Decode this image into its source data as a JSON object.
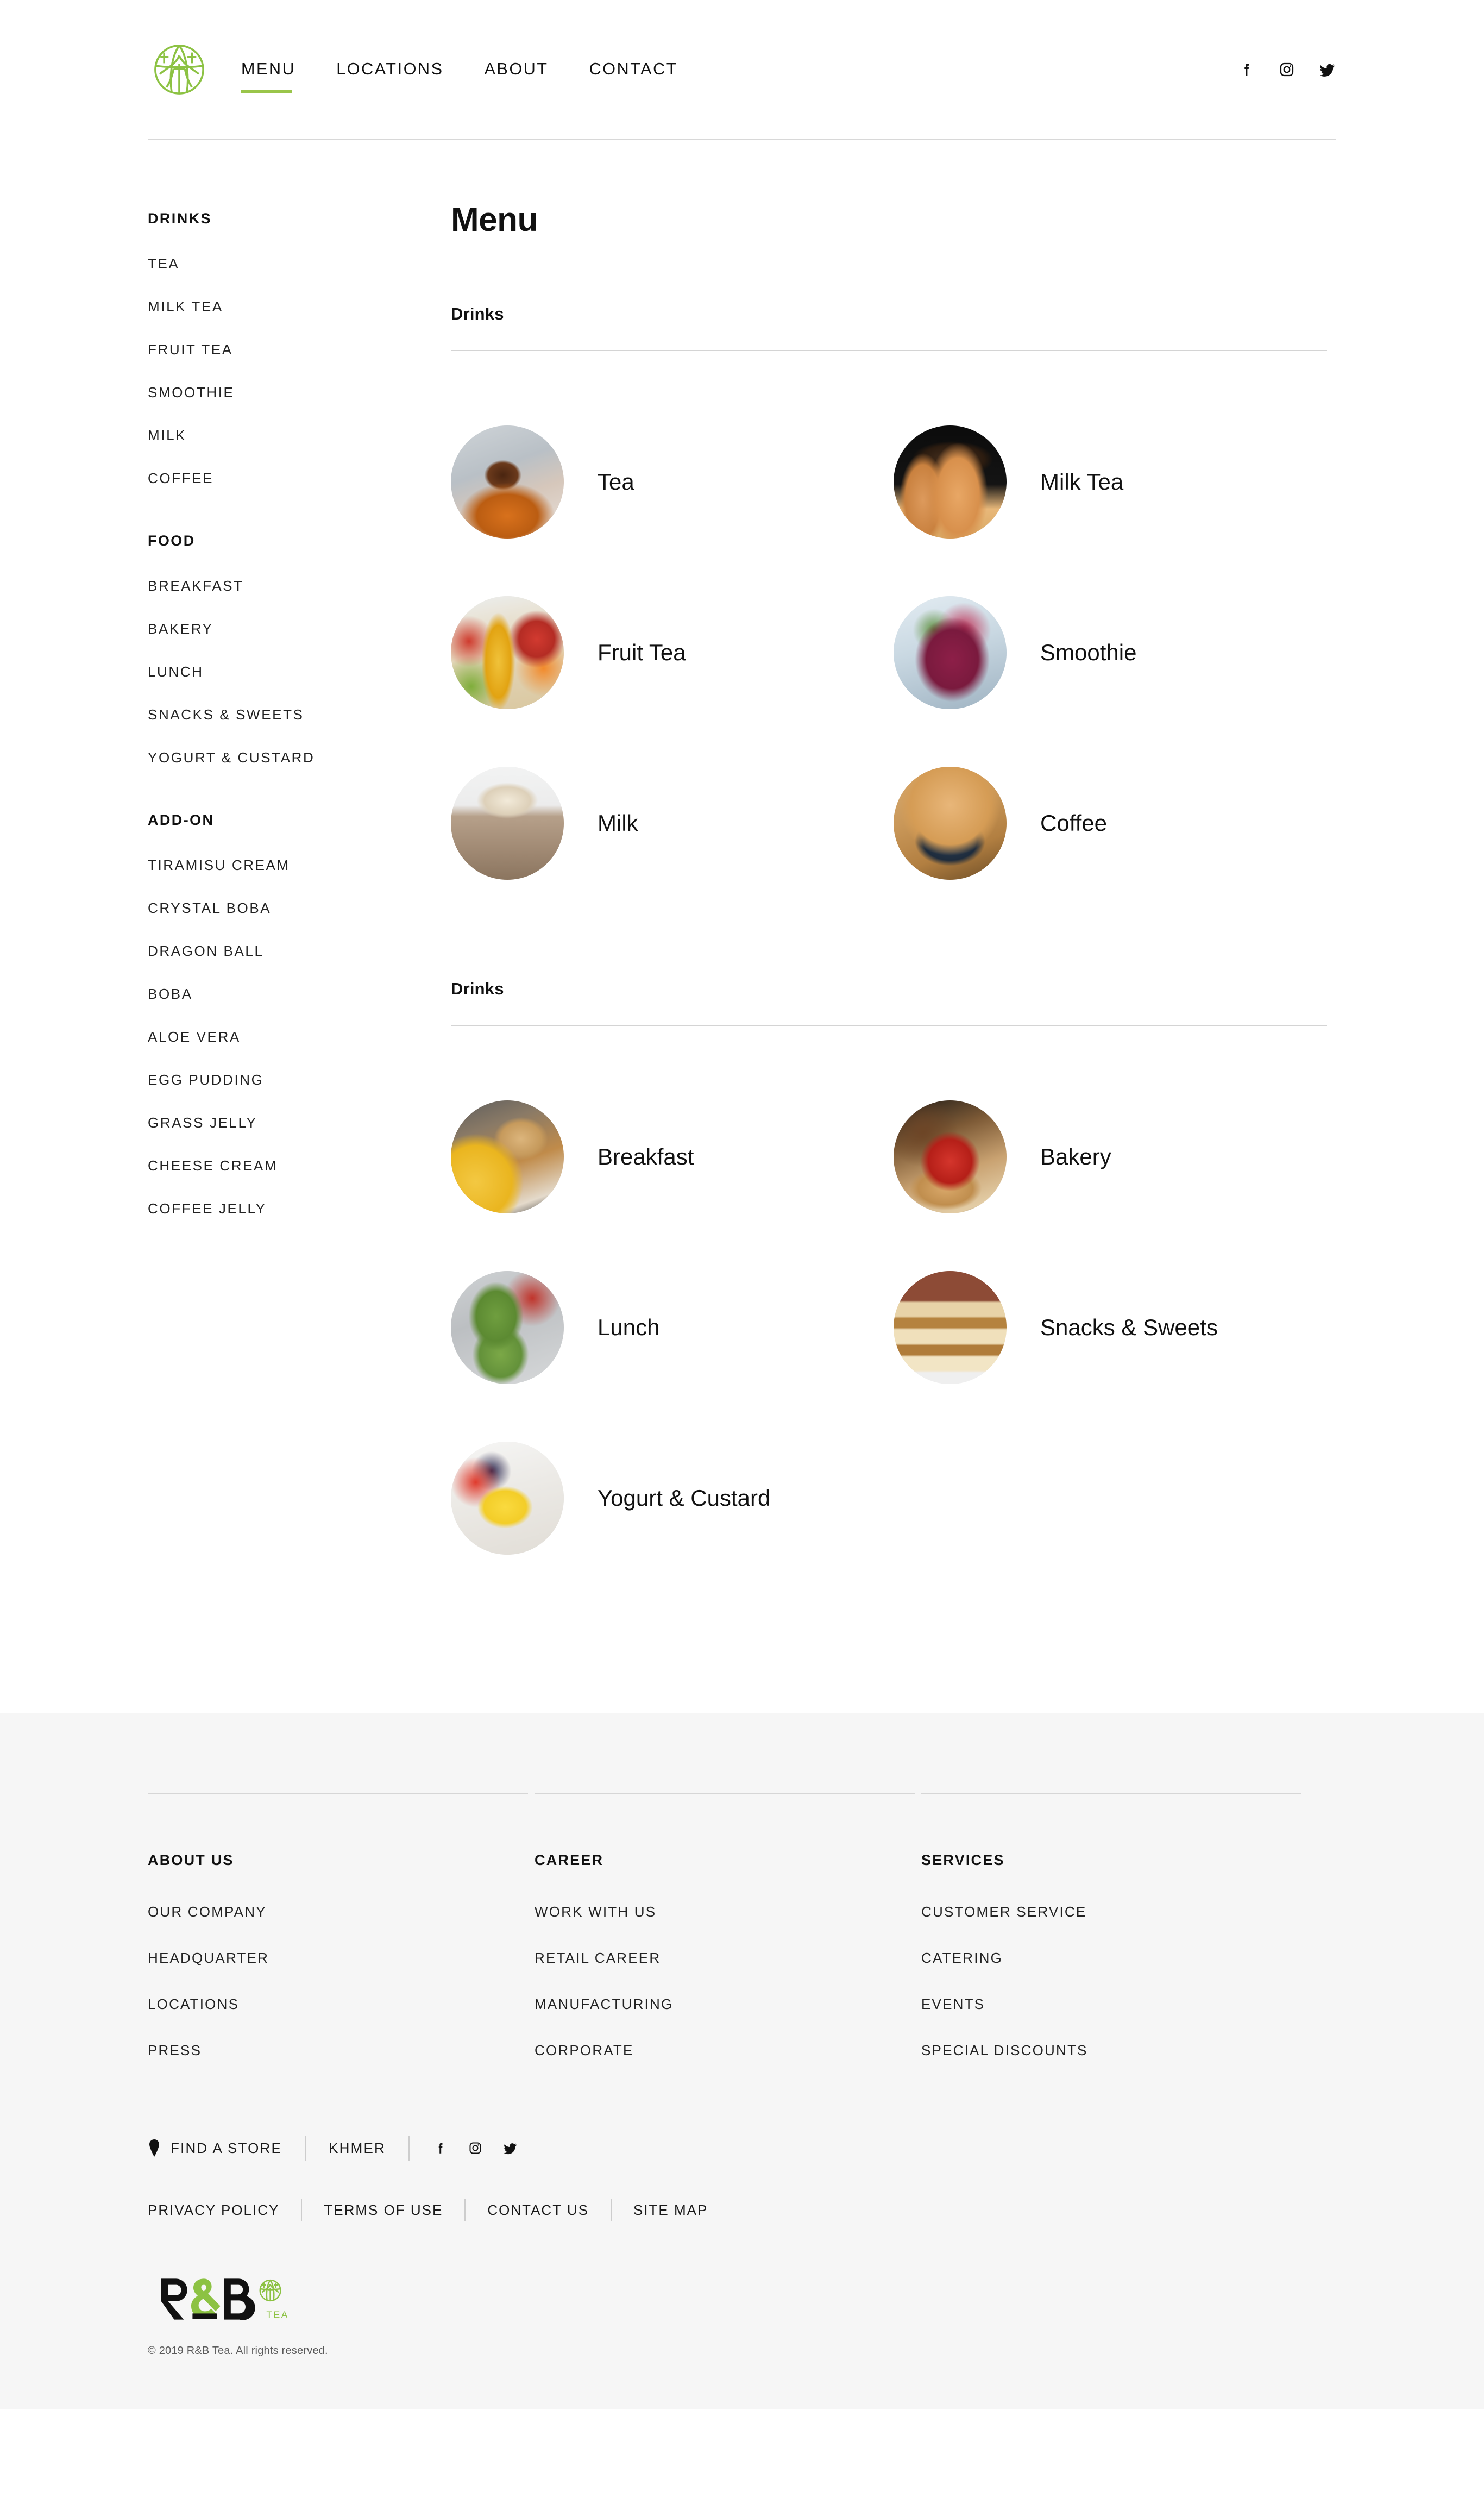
{
  "header": {
    "logo_name": "rb-tea-circular-logo",
    "nav": [
      {
        "label": "MENU",
        "active": true
      },
      {
        "label": "LOCATIONS",
        "active": false
      },
      {
        "label": "ABOUT",
        "active": false
      },
      {
        "label": "CONTACT",
        "active": false
      }
    ],
    "social": [
      {
        "name": "facebook-icon"
      },
      {
        "name": "instagram-icon"
      },
      {
        "name": "twitter-icon"
      }
    ]
  },
  "sidebar": {
    "groups": [
      {
        "title": "DRINKS",
        "items": [
          "TEA",
          "MILK TEA",
          "FRUIT TEA",
          "SMOOTHIE",
          "MILK",
          "COFFEE"
        ]
      },
      {
        "title": "FOOD",
        "items": [
          "BREAKFAST",
          "BAKERY",
          "LUNCH",
          "SNACKS & SWEETS",
          "YOGURT & CUSTARD"
        ]
      },
      {
        "title": "ADD-ON",
        "items": [
          "TIRAMISU CREAM",
          "CRYSTAL BOBA",
          "DRAGON BALL",
          "BOBA",
          "ALOE VERA",
          "EGG PUDDING",
          "GRASS JELLY",
          "CHEESE CREAM",
          "COFFEE JELLY"
        ]
      }
    ]
  },
  "main": {
    "page_title": "Menu",
    "sections": [
      {
        "heading": "Drinks",
        "items": [
          {
            "label": "Tea",
            "thumb": "ph-tea"
          },
          {
            "label": "Milk Tea",
            "thumb": "ph-milktea"
          },
          {
            "label": "Fruit Tea",
            "thumb": "ph-fruittea"
          },
          {
            "label": "Smoothie",
            "thumb": "ph-smoothie"
          },
          {
            "label": "Milk",
            "thumb": "ph-milk"
          },
          {
            "label": "Coffee",
            "thumb": "ph-coffee"
          }
        ]
      },
      {
        "heading": "Drinks",
        "items": [
          {
            "label": "Breakfast",
            "thumb": "ph-breakfast"
          },
          {
            "label": "Bakery",
            "thumb": "ph-bakery"
          },
          {
            "label": "Lunch",
            "thumb": "ph-lunch"
          },
          {
            "label": "Snacks & Sweets",
            "thumb": "ph-snacks"
          },
          {
            "label": "Yogurt & Custard",
            "thumb": "ph-yogurt"
          }
        ]
      }
    ]
  },
  "footer": {
    "columns": [
      {
        "title": "ABOUT US",
        "links": [
          "OUR COMPANY",
          "HEADQUARTER",
          "LOCATIONS",
          "PRESS"
        ]
      },
      {
        "title": "CAREER",
        "links": [
          "WORK WITH US",
          "RETAIL CAREER",
          "MANUFACTURING",
          "CORPORATE"
        ]
      },
      {
        "title": "SERVICES",
        "links": [
          "CUSTOMER SERVICE",
          "CATERING",
          "EVENTS",
          "SPECIAL DISCOUNTS"
        ]
      }
    ],
    "utility": {
      "find_a_store": "FIND A STORE",
      "language": "KHMER",
      "social": [
        {
          "name": "facebook-icon"
        },
        {
          "name": "instagram-icon"
        },
        {
          "name": "twitter-icon"
        }
      ]
    },
    "legal_links": [
      "PRIVACY POLICY",
      "TERMS OF USE",
      "CONTACT US",
      "SITE MAP"
    ],
    "brand": {
      "wordmark_r": "R",
      "wordmark_amp": "&",
      "wordmark_b": "B",
      "tea_label": "TEA"
    },
    "copyright": "© 2019 R&B Tea. All rights reserved."
  },
  "colors": {
    "accent_green": "#9ac54a",
    "text": "#111111",
    "rule": "#d6d6d6",
    "footer_bg": "#f6f6f6"
  }
}
